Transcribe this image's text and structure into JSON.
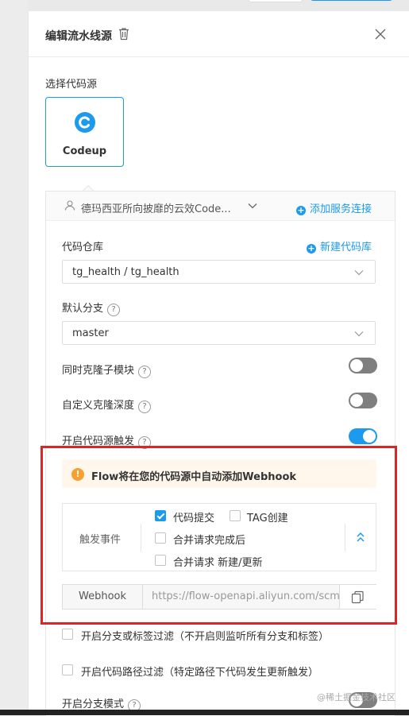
{
  "panel": {
    "title": "编辑流水线源"
  },
  "source_section": {
    "label": "选择代码源",
    "selected_source": "Codeup"
  },
  "connection": {
    "account": "德玛西亚所向披靡的云效Code...",
    "add_service_link": "添加服务连接"
  },
  "repository": {
    "label": "代码仓库",
    "new_repo_link": "新建代码库",
    "value": "tg_health / tg_health"
  },
  "branch": {
    "label": "默认分支",
    "value": "master"
  },
  "toggles": {
    "clone_submodules": {
      "label": "同时克隆子模块",
      "on": false
    },
    "custom_clone_depth": {
      "label": "自定义克隆深度",
      "on": false
    },
    "source_trigger": {
      "label": "开启代码源触发",
      "on": true
    }
  },
  "notice": {
    "text": "Flow将在您的代码源中自动添加Webhook"
  },
  "trigger": {
    "label": "触发事件",
    "options": [
      {
        "label": "代码提交",
        "checked": true
      },
      {
        "label": "TAG创建",
        "checked": false
      },
      {
        "label": "合并请求完成后",
        "checked": false
      },
      {
        "label": "合并请求 新建/更新",
        "checked": false
      }
    ]
  },
  "webhook": {
    "label": "Webhook",
    "value": "https://flow-openapi.aliyun.com/scm"
  },
  "filters": {
    "branch_filter": "开启分支或标签过滤（不开启则监听所有分支和标签）",
    "path_filter": "开启代码路径过滤（特定路径下代码发生更新触发）",
    "branch_mode": "开启分支模式"
  },
  "watermark": "@稀土掘金技术社区",
  "colors": {
    "accent": "#1b9aee",
    "warning": "#f7a030",
    "highlight_frame": "#e02424",
    "toggle_off": "#7f7f7f"
  }
}
